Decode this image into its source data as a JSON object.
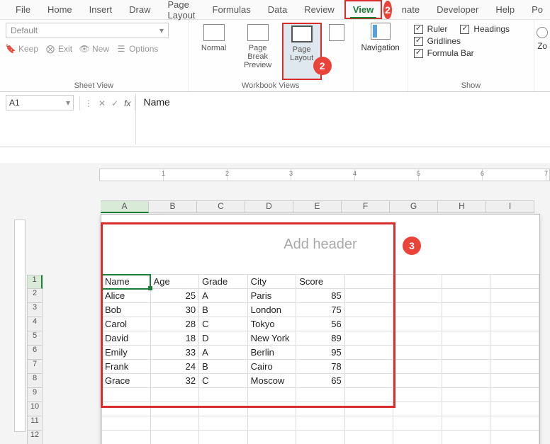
{
  "tabs": {
    "file": "File",
    "home": "Home",
    "insert": "Insert",
    "draw": "Draw",
    "page_layout": "Page Layout",
    "formulas": "Formulas",
    "data": "Data",
    "review": "Review",
    "view": "View",
    "automate_cut": "nate",
    "developer": "Developer",
    "help": "Help",
    "power_cut": "Po"
  },
  "sheet_view": {
    "combo": "Default",
    "keep": "Keep",
    "exit": "Exit",
    "new": "New",
    "options": "Options",
    "group_label": "Sheet View"
  },
  "workbook_views": {
    "normal": "Normal",
    "pbp_l1": "Page Break",
    "pbp_l2": "Preview",
    "pl_l1": "Page",
    "pl_l2": "Layout",
    "custom_cut": "",
    "group_label": "Workbook Views"
  },
  "navigation": {
    "label": "Navigation"
  },
  "show": {
    "ruler": "Ruler",
    "gridlines": "Gridlines",
    "formula_bar": "Formula Bar",
    "headings": "Headings",
    "group_label": "Show"
  },
  "zoom_cut": "Zo",
  "name_box": "A1",
  "formula_value": "Name",
  "header_placeholder": "Add header",
  "col_labels": [
    "A",
    "B",
    "C",
    "D",
    "E",
    "F",
    "G",
    "H",
    "I"
  ],
  "row_labels": [
    "1",
    "2",
    "3",
    "4",
    "5",
    "6",
    "7",
    "8",
    "9",
    "10",
    "11",
    "12"
  ],
  "grid": {
    "headers": [
      "Name",
      "Age",
      "Grade",
      "City",
      "Score"
    ],
    "rows": [
      {
        "name": "Alice",
        "age": "25",
        "grade": "A",
        "city": "Paris",
        "score": "85"
      },
      {
        "name": "Bob",
        "age": "30",
        "grade": "B",
        "city": "London",
        "score": "75"
      },
      {
        "name": "Carol",
        "age": "28",
        "grade": "C",
        "city": "Tokyo",
        "score": "56"
      },
      {
        "name": "David",
        "age": "18",
        "grade": "D",
        "city": "New York",
        "score": "89"
      },
      {
        "name": "Emily",
        "age": "33",
        "grade": "A",
        "city": "Berlin",
        "score": "95"
      },
      {
        "name": "Frank",
        "age": "24",
        "grade": "B",
        "city": "Cairo",
        "score": "78"
      },
      {
        "name": "Grace",
        "age": "32",
        "grade": "C",
        "city": "Moscow",
        "score": "65"
      }
    ]
  },
  "callouts": {
    "c2": "2",
    "c2b": "2",
    "c3": "3"
  }
}
